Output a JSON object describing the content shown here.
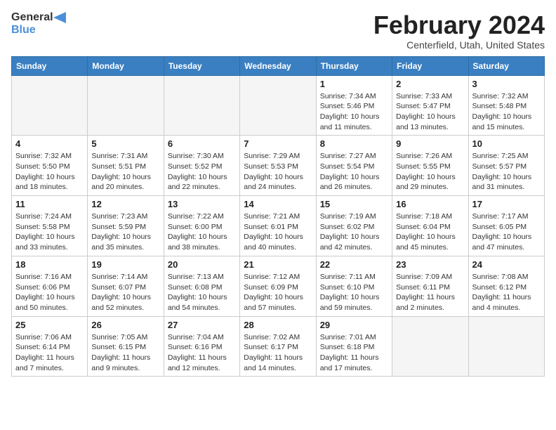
{
  "header": {
    "logo_line1": "General",
    "logo_line2": "Blue",
    "month_year": "February 2024",
    "location": "Centerfield, Utah, United States"
  },
  "days_of_week": [
    "Sunday",
    "Monday",
    "Tuesday",
    "Wednesday",
    "Thursday",
    "Friday",
    "Saturday"
  ],
  "weeks": [
    [
      {
        "day": "",
        "info": ""
      },
      {
        "day": "",
        "info": ""
      },
      {
        "day": "",
        "info": ""
      },
      {
        "day": "",
        "info": ""
      },
      {
        "day": "1",
        "info": "Sunrise: 7:34 AM\nSunset: 5:46 PM\nDaylight: 10 hours\nand 11 minutes."
      },
      {
        "day": "2",
        "info": "Sunrise: 7:33 AM\nSunset: 5:47 PM\nDaylight: 10 hours\nand 13 minutes."
      },
      {
        "day": "3",
        "info": "Sunrise: 7:32 AM\nSunset: 5:48 PM\nDaylight: 10 hours\nand 15 minutes."
      }
    ],
    [
      {
        "day": "4",
        "info": "Sunrise: 7:32 AM\nSunset: 5:50 PM\nDaylight: 10 hours\nand 18 minutes."
      },
      {
        "day": "5",
        "info": "Sunrise: 7:31 AM\nSunset: 5:51 PM\nDaylight: 10 hours\nand 20 minutes."
      },
      {
        "day": "6",
        "info": "Sunrise: 7:30 AM\nSunset: 5:52 PM\nDaylight: 10 hours\nand 22 minutes."
      },
      {
        "day": "7",
        "info": "Sunrise: 7:29 AM\nSunset: 5:53 PM\nDaylight: 10 hours\nand 24 minutes."
      },
      {
        "day": "8",
        "info": "Sunrise: 7:27 AM\nSunset: 5:54 PM\nDaylight: 10 hours\nand 26 minutes."
      },
      {
        "day": "9",
        "info": "Sunrise: 7:26 AM\nSunset: 5:55 PM\nDaylight: 10 hours\nand 29 minutes."
      },
      {
        "day": "10",
        "info": "Sunrise: 7:25 AM\nSunset: 5:57 PM\nDaylight: 10 hours\nand 31 minutes."
      }
    ],
    [
      {
        "day": "11",
        "info": "Sunrise: 7:24 AM\nSunset: 5:58 PM\nDaylight: 10 hours\nand 33 minutes."
      },
      {
        "day": "12",
        "info": "Sunrise: 7:23 AM\nSunset: 5:59 PM\nDaylight: 10 hours\nand 35 minutes."
      },
      {
        "day": "13",
        "info": "Sunrise: 7:22 AM\nSunset: 6:00 PM\nDaylight: 10 hours\nand 38 minutes."
      },
      {
        "day": "14",
        "info": "Sunrise: 7:21 AM\nSunset: 6:01 PM\nDaylight: 10 hours\nand 40 minutes."
      },
      {
        "day": "15",
        "info": "Sunrise: 7:19 AM\nSunset: 6:02 PM\nDaylight: 10 hours\nand 42 minutes."
      },
      {
        "day": "16",
        "info": "Sunrise: 7:18 AM\nSunset: 6:04 PM\nDaylight: 10 hours\nand 45 minutes."
      },
      {
        "day": "17",
        "info": "Sunrise: 7:17 AM\nSunset: 6:05 PM\nDaylight: 10 hours\nand 47 minutes."
      }
    ],
    [
      {
        "day": "18",
        "info": "Sunrise: 7:16 AM\nSunset: 6:06 PM\nDaylight: 10 hours\nand 50 minutes."
      },
      {
        "day": "19",
        "info": "Sunrise: 7:14 AM\nSunset: 6:07 PM\nDaylight: 10 hours\nand 52 minutes."
      },
      {
        "day": "20",
        "info": "Sunrise: 7:13 AM\nSunset: 6:08 PM\nDaylight: 10 hours\nand 54 minutes."
      },
      {
        "day": "21",
        "info": "Sunrise: 7:12 AM\nSunset: 6:09 PM\nDaylight: 10 hours\nand 57 minutes."
      },
      {
        "day": "22",
        "info": "Sunrise: 7:11 AM\nSunset: 6:10 PM\nDaylight: 10 hours\nand 59 minutes."
      },
      {
        "day": "23",
        "info": "Sunrise: 7:09 AM\nSunset: 6:11 PM\nDaylight: 11 hours\nand 2 minutes."
      },
      {
        "day": "24",
        "info": "Sunrise: 7:08 AM\nSunset: 6:12 PM\nDaylight: 11 hours\nand 4 minutes."
      }
    ],
    [
      {
        "day": "25",
        "info": "Sunrise: 7:06 AM\nSunset: 6:14 PM\nDaylight: 11 hours\nand 7 minutes."
      },
      {
        "day": "26",
        "info": "Sunrise: 7:05 AM\nSunset: 6:15 PM\nDaylight: 11 hours\nand 9 minutes."
      },
      {
        "day": "27",
        "info": "Sunrise: 7:04 AM\nSunset: 6:16 PM\nDaylight: 11 hours\nand 12 minutes."
      },
      {
        "day": "28",
        "info": "Sunrise: 7:02 AM\nSunset: 6:17 PM\nDaylight: 11 hours\nand 14 minutes."
      },
      {
        "day": "29",
        "info": "Sunrise: 7:01 AM\nSunset: 6:18 PM\nDaylight: 11 hours\nand 17 minutes."
      },
      {
        "day": "",
        "info": ""
      },
      {
        "day": "",
        "info": ""
      }
    ]
  ]
}
